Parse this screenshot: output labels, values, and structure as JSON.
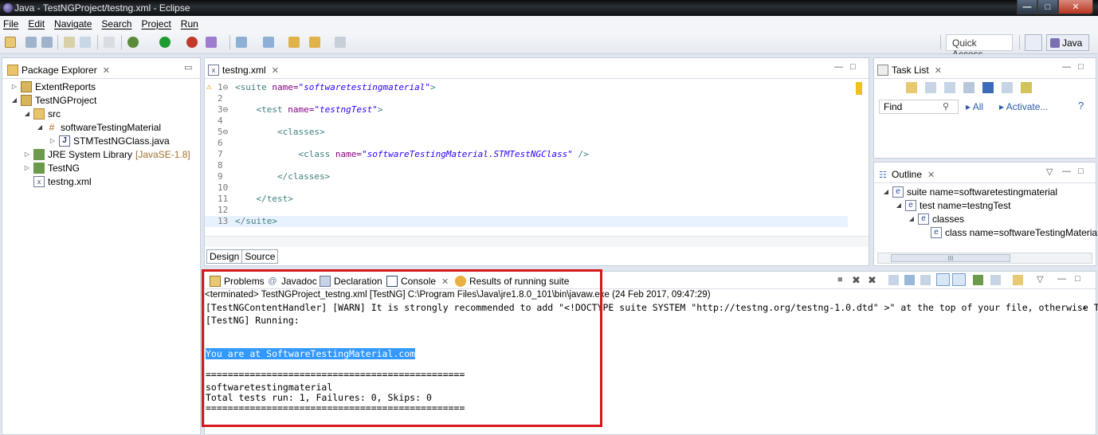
{
  "window": {
    "title": "Java - TestNGProject/testng.xml - Eclipse",
    "buttons": {
      "minimize": "—",
      "maximize": "□",
      "close": "✕"
    }
  },
  "menu": [
    "File",
    "Edit",
    "Navigate",
    "Search",
    "Project",
    "Run"
  ],
  "toolbar": {
    "quick_access": "Quick Access",
    "perspective": "Java"
  },
  "package_explorer": {
    "tab": "Package Explorer",
    "items": [
      {
        "label": "ExtentReports",
        "icon": "project-icon"
      },
      {
        "label": "TestNGProject",
        "icon": "project-icon"
      },
      {
        "label": "src",
        "icon": "source-folder-icon"
      },
      {
        "label": "softwareTestingMaterial",
        "icon": "package-icon"
      },
      {
        "label": "STMTestNGClass.java",
        "icon": "java-file-icon"
      },
      {
        "label": "JRE System Library",
        "suffix": "[JavaSE-1.8]",
        "icon": "library-icon"
      },
      {
        "label": "TestNG",
        "icon": "library-icon"
      },
      {
        "label": "testng.xml",
        "icon": "xml-file-icon"
      }
    ]
  },
  "editor": {
    "tab": "testng.xml",
    "lines": [
      {
        "n": "1",
        "parts": [
          [
            "t",
            "<suite "
          ],
          [
            "a",
            "name="
          ],
          [
            "v",
            "\"softwaretestingmaterial\""
          ],
          [
            "t",
            ">"
          ]
        ]
      },
      {
        "n": "2",
        "parts": []
      },
      {
        "n": "3",
        "parts": [
          [
            "s",
            "    "
          ],
          [
            "t",
            "<test "
          ],
          [
            "a",
            "name="
          ],
          [
            "v",
            "\"testngTest\""
          ],
          [
            "t",
            ">"
          ]
        ]
      },
      {
        "n": "4",
        "parts": []
      },
      {
        "n": "5",
        "parts": [
          [
            "s",
            "        "
          ],
          [
            "t",
            "<classes>"
          ]
        ]
      },
      {
        "n": "6",
        "parts": []
      },
      {
        "n": "7",
        "parts": [
          [
            "s",
            "            "
          ],
          [
            "t",
            "<class "
          ],
          [
            "a",
            "name="
          ],
          [
            "v",
            "\"softwareTesting​Material.STMTestNGClass\""
          ],
          [
            "t",
            " />"
          ]
        ]
      },
      {
        "n": "8",
        "parts": []
      },
      {
        "n": "9",
        "parts": [
          [
            "s",
            "        "
          ],
          [
            "t",
            "</classes>"
          ]
        ]
      },
      {
        "n": "10",
        "parts": []
      },
      {
        "n": "11",
        "parts": [
          [
            "s",
            "    "
          ],
          [
            "t",
            "</test>"
          ]
        ]
      },
      {
        "n": "12",
        "parts": []
      },
      {
        "n": "13",
        "parts": [
          [
            "t",
            "</suite>"
          ]
        ]
      }
    ],
    "bottom_tabs": [
      "Design",
      "Source"
    ]
  },
  "task_list": {
    "tab": "Task List",
    "find_placeholder": "Find",
    "all": "All",
    "activate": "Activate..."
  },
  "outline": {
    "tab": "Outline",
    "items": [
      "suite name=softwaretestingmaterial",
      "test name=testngTest",
      "classes",
      "class name=softwareTestingMateria"
    ],
    "scroll_grip": "III"
  },
  "console": {
    "tabs": [
      "Problems",
      "Javadoc",
      "Declaration",
      "Console",
      "Results of running suite"
    ],
    "terminated": "<terminated> TestNGProject_testng.xml [TestNG] C:\\Program Files\\Java\\jre1.8.0_101\\bin\\javaw.exe (24 Feb 2017, 09:47:29)",
    "lines": [
      "[TestNGContentHandler] [WARN] It is strongly recommended to add \"<!DOCTYPE suite SYSTEM \"http://testng.org/testng-1.0.dtd\" >\" at the top of your file, otherwise TestNG",
      "[TestNG] Running:",
      "",
      "",
      "You are at SoftwareTestingMaterial.com",
      "",
      "===============================================",
      "softwaretestingmaterial",
      "Total tests run: 1, Failures: 0, Skips: 0",
      "==============================================="
    ]
  }
}
